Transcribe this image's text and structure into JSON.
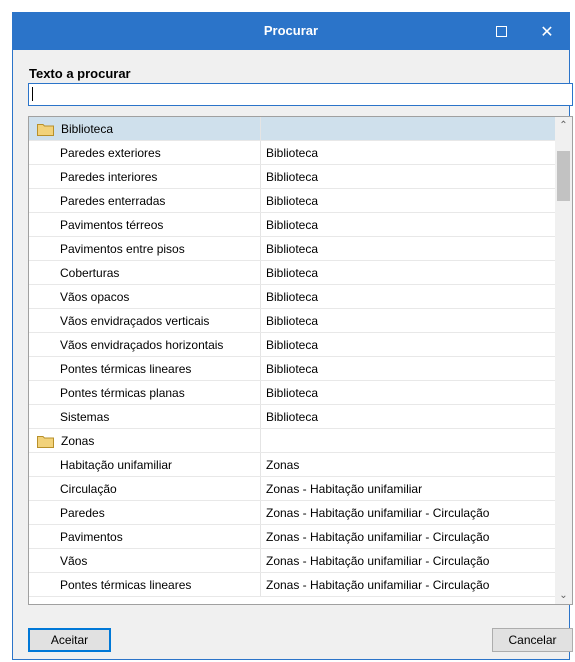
{
  "window": {
    "title": "Procurar"
  },
  "search": {
    "label": "Texto a procurar",
    "value": ""
  },
  "list": {
    "rows": [
      {
        "type": "group",
        "name": "Biblioteca",
        "path": "",
        "selected": true
      },
      {
        "type": "item",
        "name": "Paredes exteriores",
        "path": "Biblioteca"
      },
      {
        "type": "item",
        "name": "Paredes interiores",
        "path": "Biblioteca"
      },
      {
        "type": "item",
        "name": "Paredes enterradas",
        "path": "Biblioteca"
      },
      {
        "type": "item",
        "name": "Pavimentos térreos",
        "path": "Biblioteca"
      },
      {
        "type": "item",
        "name": "Pavimentos entre pisos",
        "path": "Biblioteca"
      },
      {
        "type": "item",
        "name": "Coberturas",
        "path": "Biblioteca"
      },
      {
        "type": "item",
        "name": "Vãos opacos",
        "path": "Biblioteca"
      },
      {
        "type": "item",
        "name": "Vãos envidraçados verticais",
        "path": "Biblioteca"
      },
      {
        "type": "item",
        "name": "Vãos envidraçados horizontais",
        "path": "Biblioteca"
      },
      {
        "type": "item",
        "name": "Pontes térmicas lineares",
        "path": "Biblioteca"
      },
      {
        "type": "item",
        "name": "Pontes térmicas planas",
        "path": "Biblioteca"
      },
      {
        "type": "item",
        "name": "Sistemas",
        "path": "Biblioteca"
      },
      {
        "type": "group",
        "name": "Zonas",
        "path": ""
      },
      {
        "type": "item",
        "name": "Habitação unifamiliar",
        "path": "Zonas"
      },
      {
        "type": "item",
        "name": "Circulação",
        "path": "Zonas - Habitação unifamiliar"
      },
      {
        "type": "item",
        "name": "Paredes",
        "path": "Zonas - Habitação unifamiliar - Circulação"
      },
      {
        "type": "item",
        "name": "Pavimentos",
        "path": "Zonas - Habitação unifamiliar - Circulação"
      },
      {
        "type": "item",
        "name": "Vãos",
        "path": "Zonas - Habitação unifamiliar - Circulação"
      },
      {
        "type": "item",
        "name": "Pontes térmicas lineares",
        "path": "Zonas - Habitação unifamiliar - Circulação"
      }
    ]
  },
  "buttons": {
    "ok": "Aceitar",
    "cancel": "Cancelar"
  },
  "icons": {
    "folder": "folder-icon",
    "maximize": "maximize-icon",
    "close": "close-icon",
    "scroll_up": "chevron-up-icon",
    "scroll_down": "chevron-down-icon"
  },
  "colors": {
    "titlebar": "#2b74c9",
    "selected_row": "#cfe0ec",
    "folder": "#f2d27a"
  }
}
